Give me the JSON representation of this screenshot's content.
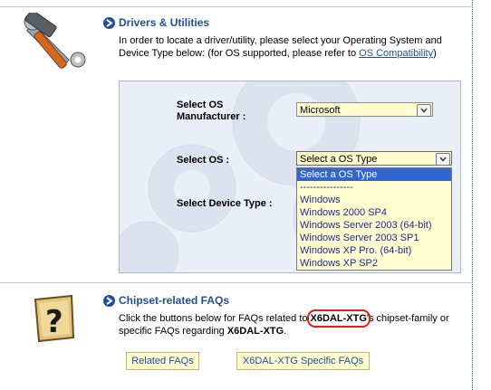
{
  "drivers": {
    "title": "Drivers & Utilities",
    "intro_1": "In order to locate a driver/utility, please select your Operating System and",
    "intro_2": "Device Type below: (for OS supported, please refer to ",
    "os_compat_link": "OS Compatibility",
    "intro_end": ")"
  },
  "form": {
    "manufacturer_label_1": "Select OS",
    "manufacturer_label_2": "Manufacturer :",
    "manufacturer_value": "Microsoft",
    "os_label": "Select OS :",
    "os_value": "Select a OS Type",
    "device_label": "Select Device Type :"
  },
  "os_dropdown": {
    "options": [
      "Select a OS Type",
      "----------------",
      "Windows",
      "Windows 2000 SP4",
      "Windows Server 2003 (64-bit)",
      "Windows Server 2003 SP1",
      "Windows XP Pro. (64-bit)",
      "Windows XP SP2"
    ],
    "selected_index": 0
  },
  "faqs": {
    "title": "Chipset-related FAQs",
    "line1_pre": "Click the buttons below  for FAQs related to ",
    "model": "X6DAL-XTG",
    "line1_post": "'s chipset-family or",
    "line2_pre": "specific FAQs regarding ",
    "line2_model": "X6DAL-XTG",
    "line2_post": ".",
    "btn_related": "Related FAQs",
    "btn_specific": "X6DAL-XTG Specific FAQs"
  },
  "colors": {
    "accent": "#1f4e9b",
    "field_bg": "#fffcd0",
    "highlight_circle": "#e41b17",
    "selected_option": "#3366cc"
  }
}
